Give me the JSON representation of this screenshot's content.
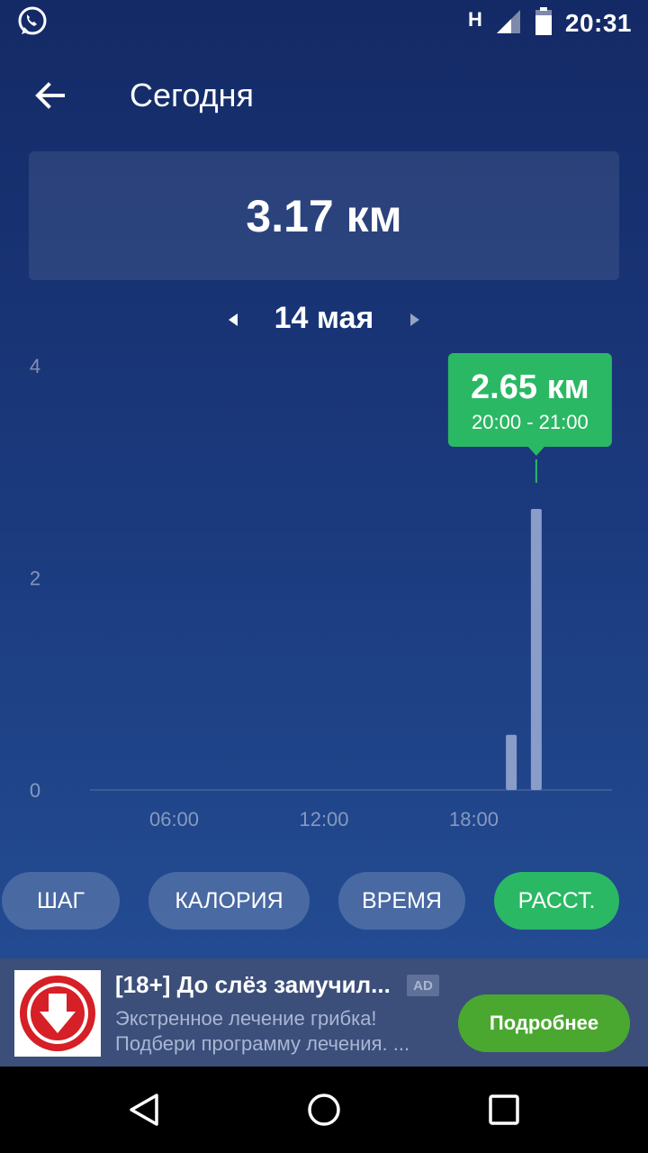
{
  "status_bar": {
    "time": "20:31",
    "network_label": "H",
    "icons": [
      "whatsapp-icon",
      "signal-icon",
      "battery-icon"
    ]
  },
  "app_bar": {
    "title": "Сегодня",
    "back_icon": "arrow-left-icon"
  },
  "summary": {
    "total_distance": "3.17 км"
  },
  "date_nav": {
    "label": "14 мая",
    "prev_icon": "triangle-left-icon",
    "next_icon": "triangle-right-icon"
  },
  "tooltip": {
    "value": "2.65 км",
    "range": "20:00 - 21:00",
    "color": "#2bb864"
  },
  "chart_data": {
    "type": "bar",
    "ylim": [
      0,
      4
    ],
    "yticks": [
      "0",
      "2",
      "4"
    ],
    "xticks": [
      "06:00",
      "12:00",
      "18:00"
    ],
    "xrange_hours": [
      0,
      24
    ],
    "bars": [
      {
        "hour": 19,
        "value": 0.52
      },
      {
        "hour": 20,
        "value": 2.65
      }
    ],
    "selected_hour": 20,
    "bar_color": "#8a9cc8",
    "grid": false
  },
  "tabs": [
    {
      "label": "ШАГ",
      "active": false
    },
    {
      "label": "КАЛОРИЯ",
      "active": false
    },
    {
      "label": "ВРЕМЯ",
      "active": false
    },
    {
      "label": "РАССТ.",
      "active": true
    }
  ],
  "ad": {
    "title": "[18+] До слёз замучил...",
    "badge": "AD",
    "line1": "Экстренное лечение грибка!",
    "line2": "Подбери программу лечения. ...",
    "button": "Подробнее",
    "button_color": "#4aa830"
  },
  "nav_bar": {
    "icons": [
      "back-triangle-icon",
      "home-circle-icon",
      "recents-square-icon"
    ]
  }
}
